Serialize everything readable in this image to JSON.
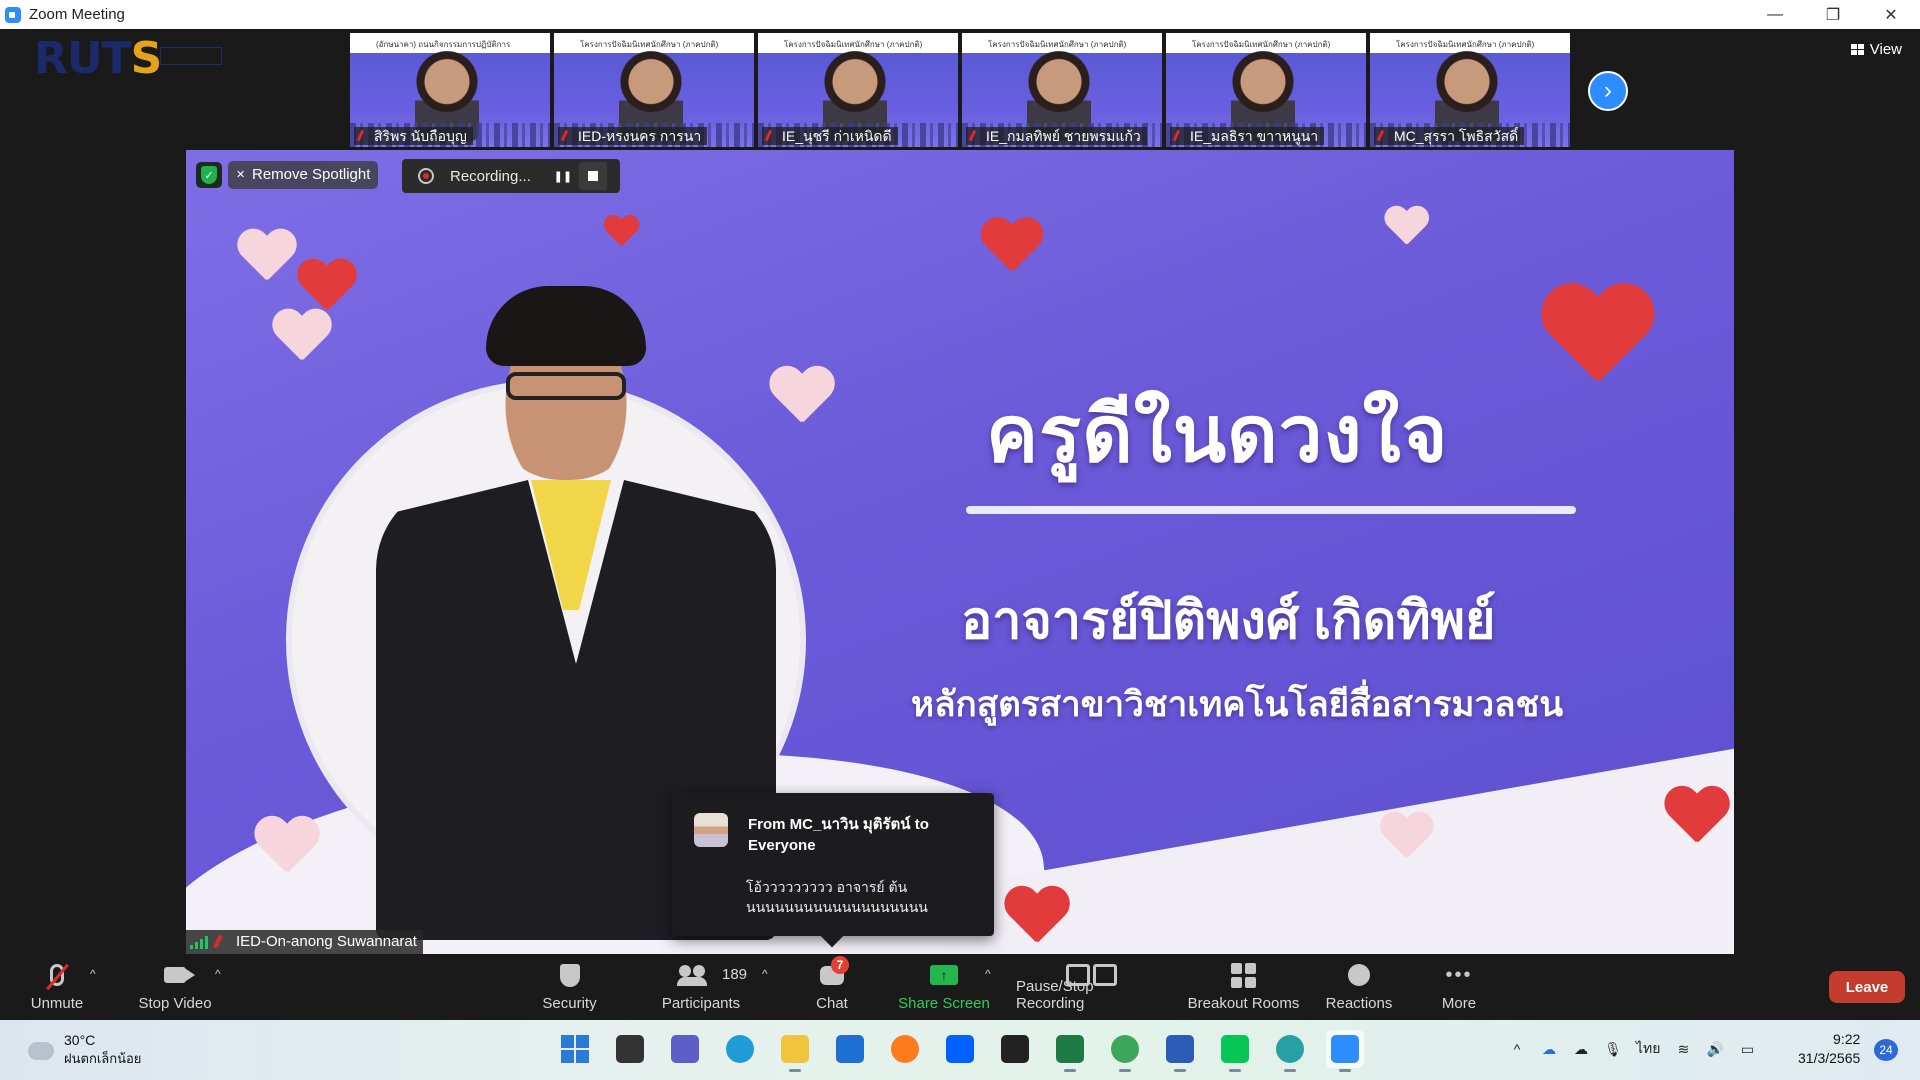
{
  "window": {
    "title": "Zoom Meeting",
    "controls": {
      "minimize": "—",
      "restore": "❐",
      "close": "✕"
    }
  },
  "logo": {
    "text_a": "RUT",
    "text_b": "S"
  },
  "view_button": {
    "label": "View"
  },
  "thumbnails": [
    {
      "name": "สิริพร นับถือบุญ",
      "banner": "(อักษนาคา) ถนนกิจกรรมการปฏิบัติการ"
    },
    {
      "name": "IED-หรงนคร การนา",
      "banner": "โครงการปัจฉิมนิเทศนักศึกษา (ภาคปกติ)"
    },
    {
      "name": "IE_นุชรี ก่าเหนิดดี",
      "banner": "โครงการปัจฉิมนิเทศนักศึกษา (ภาคปกติ)"
    },
    {
      "name": "IE_กมลทิพย์ ชายพรมแก้ว",
      "banner": "โครงการปัจฉิมนิเทศนักศึกษา (ภาคปกติ)"
    },
    {
      "name": "IE_มลธิรา ขาาหนูนา",
      "banner": "โครงการปัจฉิมนิเทศนักศึกษา (ภาคปกติ)"
    },
    {
      "name": "MC_สุรรา โพธิสวัสดิ์",
      "banner": "โครงการปัจฉิมนิเทศนักศึกษา (ภาคปกติ)"
    }
  ],
  "spotlight": {
    "remove_label": "Remove Spotlight"
  },
  "recording": {
    "status": "Recording..."
  },
  "slide": {
    "title": "ครูดีในดวงใจ",
    "name": "อาจารย์ปิติพงศ์ เกิดทิพย์",
    "course": "หลักสูตรสาขาวิชาเทคโนโลยีสื่อสารมวลชน"
  },
  "active_speaker": {
    "name": "IED-On-anong Suwannarat"
  },
  "chat_popup": {
    "from": "From MC_นาวิน มุติรัตน์ to Everyone",
    "message": "โอ้ววววววววว อาจารย์ ต้นนนนนนนนนนนนนนนนนนนน"
  },
  "toolbar": {
    "unmute": "Unmute",
    "stop_video": "Stop Video",
    "security": "Security",
    "participants": "Participants",
    "participants_count": "189",
    "chat": "Chat",
    "chat_badge": "7",
    "share_screen": "Share Screen",
    "pause_stop_recording": "Pause/Stop Recording",
    "breakout_rooms": "Breakout Rooms",
    "reactions": "Reactions",
    "more": "More",
    "leave": "Leave"
  },
  "taskbar": {
    "temperature": "30°C",
    "weather_desc": "ฝนตกเล็กน้อย",
    "language": "ไทย",
    "time": "9:22",
    "date": "31/3/2565",
    "notification_count": "24",
    "apps": [
      {
        "name": "start-icon",
        "color": "#2b7bd6"
      },
      {
        "name": "task-view-icon",
        "color": "#333333"
      },
      {
        "name": "teams-chat-icon",
        "color": "#5b5fc7"
      },
      {
        "name": "edge-icon",
        "color": "#1f9cd8"
      },
      {
        "name": "file-explorer-icon",
        "color": "#f0c43c"
      },
      {
        "name": "mail-icon",
        "color": "#1d6fd1"
      },
      {
        "name": "firefox-icon",
        "color": "#ff7a1a"
      },
      {
        "name": "dropbox-icon",
        "color": "#0061fe"
      },
      {
        "name": "amazon-icon",
        "color": "#222222"
      },
      {
        "name": "excel-icon",
        "color": "#1d7a45"
      },
      {
        "name": "chrome-icon",
        "color": "#3ea65a"
      },
      {
        "name": "word-icon",
        "color": "#2b5cb8"
      },
      {
        "name": "line-icon",
        "color": "#06c755"
      },
      {
        "name": "edge-beta-icon",
        "color": "#27a0a4"
      },
      {
        "name": "zoom-icon",
        "color": "#2d8cff"
      }
    ]
  }
}
